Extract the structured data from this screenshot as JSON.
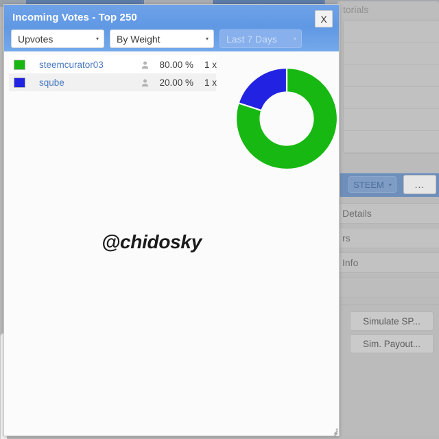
{
  "dialog": {
    "title": "Incoming Votes - Top 250",
    "close_label": "X",
    "filters": [
      {
        "name": "vote-type",
        "value": "Upvotes",
        "caret": "▾",
        "disabled": false
      },
      {
        "name": "sort-mode",
        "value": "By Weight",
        "caret": "▾",
        "disabled": false
      },
      {
        "name": "date-range",
        "value": "Last 7 Days",
        "caret": "▾",
        "disabled": true
      }
    ],
    "rows": [
      {
        "color": "#18b812",
        "account": "steemcurator03",
        "percent": "80.00 %",
        "count": "1 x"
      },
      {
        "color": "#2222e2",
        "account": "sqube",
        "percent": "20.00 %",
        "count": "1 x"
      }
    ],
    "watermark": "@chidosky"
  },
  "chart_data": {
    "type": "pie",
    "variant": "donut",
    "title": "Incoming Votes - Top 250",
    "labels": [
      "steemcurator03",
      "sqube"
    ],
    "values": [
      80.0,
      20.0
    ],
    "value_labels": [
      "80.00 %",
      "20.00 %"
    ],
    "colors": [
      "#18b812",
      "#2222e2"
    ],
    "units": "percent",
    "start_angle_deg": 0,
    "direction": "clockwise",
    "inner_radius_ratio": 0.52,
    "legend": "left-list",
    "grid": false
  },
  "background": {
    "tutorials_label": "torials",
    "steem_select": "STEEM",
    "steem_caret": "▾",
    "dots_button": "...",
    "detail_buttons": [
      "Details",
      "rs",
      "Info",
      ""
    ],
    "sim_buttons": [
      "Simulate SP...",
      "Sim. Payout..."
    ]
  }
}
